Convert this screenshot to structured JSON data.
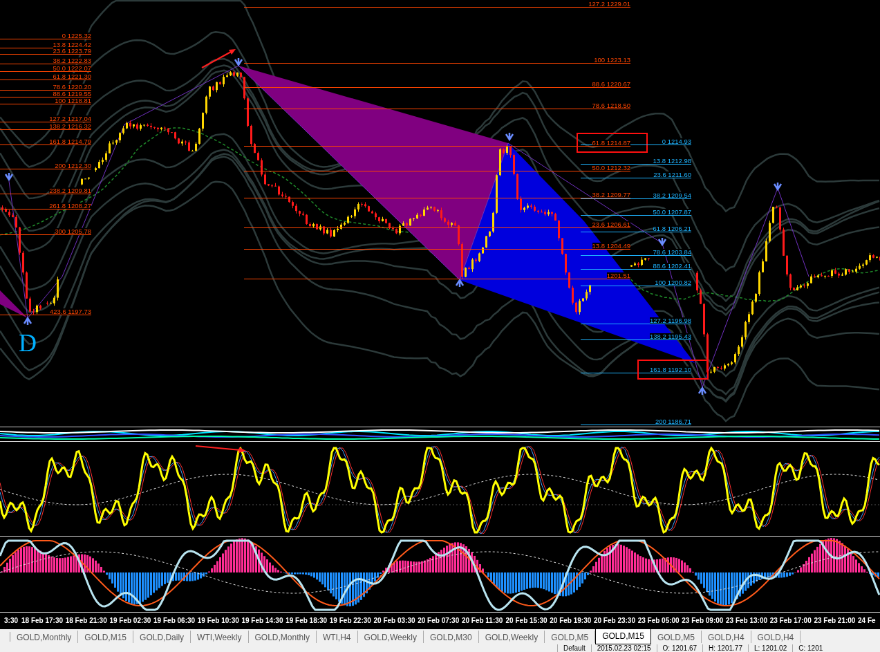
{
  "main_chart": {
    "pattern_label": "D",
    "fibonacci_sets": [
      {
        "color": "#ff4500",
        "levels": [
          {
            "label": "0 1225.32",
            "highlighted": false
          },
          {
            "label": "13.8 1224.42",
            "highlighted": false
          },
          {
            "label": "23.6 1223.79",
            "highlighted": false
          },
          {
            "label": "38.2 1222.83",
            "highlighted": false
          },
          {
            "label": "50.0 1222.07",
            "highlighted": false
          },
          {
            "label": "61.8 1221.30",
            "highlighted": false
          },
          {
            "label": "78.6 1220.20",
            "highlighted": false
          },
          {
            "label": "88.6 1219.55",
            "highlighted": false
          },
          {
            "label": "100 1218.81",
            "highlighted": false
          },
          {
            "label": "127.2 1217.04",
            "highlighted": false
          },
          {
            "label": "138.2 1216.32",
            "highlighted": false
          },
          {
            "label": "161.8 1214.79",
            "highlighted": false
          },
          {
            "label": "200 1212.30",
            "highlighted": false
          },
          {
            "label": "238.2 1209.81",
            "highlighted": false
          },
          {
            "label": "261.8 1208.27",
            "highlighted": false
          },
          {
            "label": "300 1205.78",
            "highlighted": false
          },
          {
            "label": "423.6 1197.73",
            "highlighted": false
          }
        ]
      },
      {
        "color": "#ff4500",
        "levels": [
          {
            "label": "127.2 1229.01",
            "highlighted": false
          },
          {
            "label": "100 1223.13",
            "highlighted": false
          },
          {
            "label": "88.6 1220.67",
            "highlighted": false
          },
          {
            "label": "78.6 1218.50",
            "highlighted": false
          },
          {
            "label": "61.8 1214.87",
            "highlighted": true
          },
          {
            "label": "50.0 1212.32",
            "highlighted": false
          },
          {
            "label": "38.2 1209.77",
            "highlighted": false
          },
          {
            "label": "23.6 1206.61",
            "highlighted": false
          },
          {
            "label": "13.8 1204.49",
            "highlighted": false
          },
          {
            "label": "1201.51",
            "highlighted": false
          }
        ]
      },
      {
        "color": "#1eb4ff",
        "levels": [
          {
            "label": "0 1214.93",
            "highlighted": false
          },
          {
            "label": "13.8 1212.98",
            "highlighted": false
          },
          {
            "label": "23.6 1211.60",
            "highlighted": false
          },
          {
            "label": "38.2 1209.54",
            "highlighted": false
          },
          {
            "label": "50.0 1207.87",
            "highlighted": false
          },
          {
            "label": "61.8 1206.21",
            "highlighted": false
          },
          {
            "label": "78.6 1203.84",
            "highlighted": false
          },
          {
            "label": "88.6 1202.41",
            "highlighted": false
          },
          {
            "label": "100 1200.82",
            "highlighted": false
          },
          {
            "label": "127.2 1196.98",
            "highlighted": false
          },
          {
            "label": "138.2 1195.43",
            "highlighted": false
          },
          {
            "label": "161.8 1192.10",
            "highlighted": true
          },
          {
            "label": "200 1186.71",
            "highlighted": false
          }
        ]
      }
    ]
  },
  "time_axis": {
    "labels": [
      "3:30",
      "18 Feb 17:30",
      "18 Feb 21:30",
      "19 Feb 02:30",
      "19 Feb 06:30",
      "19 Feb 10:30",
      "19 Feb 14:30",
      "19 Feb 18:30",
      "19 Feb 22:30",
      "20 Feb 03:30",
      "20 Feb 07:30",
      "20 Feb 11:30",
      "20 Feb 15:30",
      "20 Feb 19:30",
      "20 Feb 23:30",
      "23 Feb 05:00",
      "23 Feb 09:00",
      "23 Feb 13:00",
      "23 Feb 17:00",
      "23 Feb 21:00",
      "24 Fe"
    ]
  },
  "tabs": [
    {
      "label": "GOLD,Monthly",
      "selected": false
    },
    {
      "label": "GOLD,M15",
      "selected": false
    },
    {
      "label": "GOLD,Daily",
      "selected": false
    },
    {
      "label": "WTI,Weekly",
      "selected": false
    },
    {
      "label": "GOLD,Monthly",
      "selected": false
    },
    {
      "label": "WTI,H4",
      "selected": false
    },
    {
      "label": "GOLD,Weekly",
      "selected": false
    },
    {
      "label": "GOLD,M30",
      "selected": false
    },
    {
      "label": "GOLD,Weekly",
      "selected": false
    },
    {
      "label": "GOLD,M5",
      "selected": false
    },
    {
      "label": "GOLD,M15",
      "selected": true
    },
    {
      "label": "GOLD,M5",
      "selected": false
    },
    {
      "label": "GOLD,H4",
      "selected": false
    },
    {
      "label": "GOLD,H4",
      "selected": false
    }
  ],
  "status_bar": {
    "fields": [
      "Default",
      "2015.02.23 02:15",
      "O: 1201.67",
      "H: 1201.77",
      "L: 1201.02",
      "C: 1201"
    ]
  }
}
